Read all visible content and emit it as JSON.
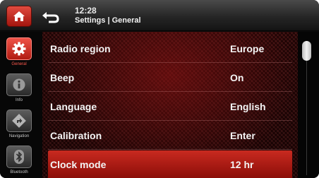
{
  "header": {
    "time": "12:28",
    "title": "Settings | General",
    "home_icon": "home-icon",
    "back_icon": "back-arrow-icon"
  },
  "sidebar": {
    "items": [
      {
        "label": "General",
        "icon": "gear-icon",
        "active": true
      },
      {
        "label": "Info",
        "icon": "info-icon",
        "active": false
      },
      {
        "label": "Navigation",
        "icon": "navigation-icon",
        "active": false
      },
      {
        "label": "Bluetooth",
        "icon": "bluetooth-icon",
        "active": false
      }
    ]
  },
  "settings": {
    "rows": [
      {
        "label": "Radio region",
        "value": "Europe"
      },
      {
        "label": "Beep",
        "value": "On"
      },
      {
        "label": "Language",
        "value": "English"
      },
      {
        "label": "Calibration",
        "value": "Enter"
      },
      {
        "label": "Clock mode",
        "value": "12 hr",
        "selected": true
      }
    ]
  },
  "colors": {
    "accent": "#c92a20",
    "active_label": "#ff5a4e",
    "text": "#f4f4f4"
  }
}
